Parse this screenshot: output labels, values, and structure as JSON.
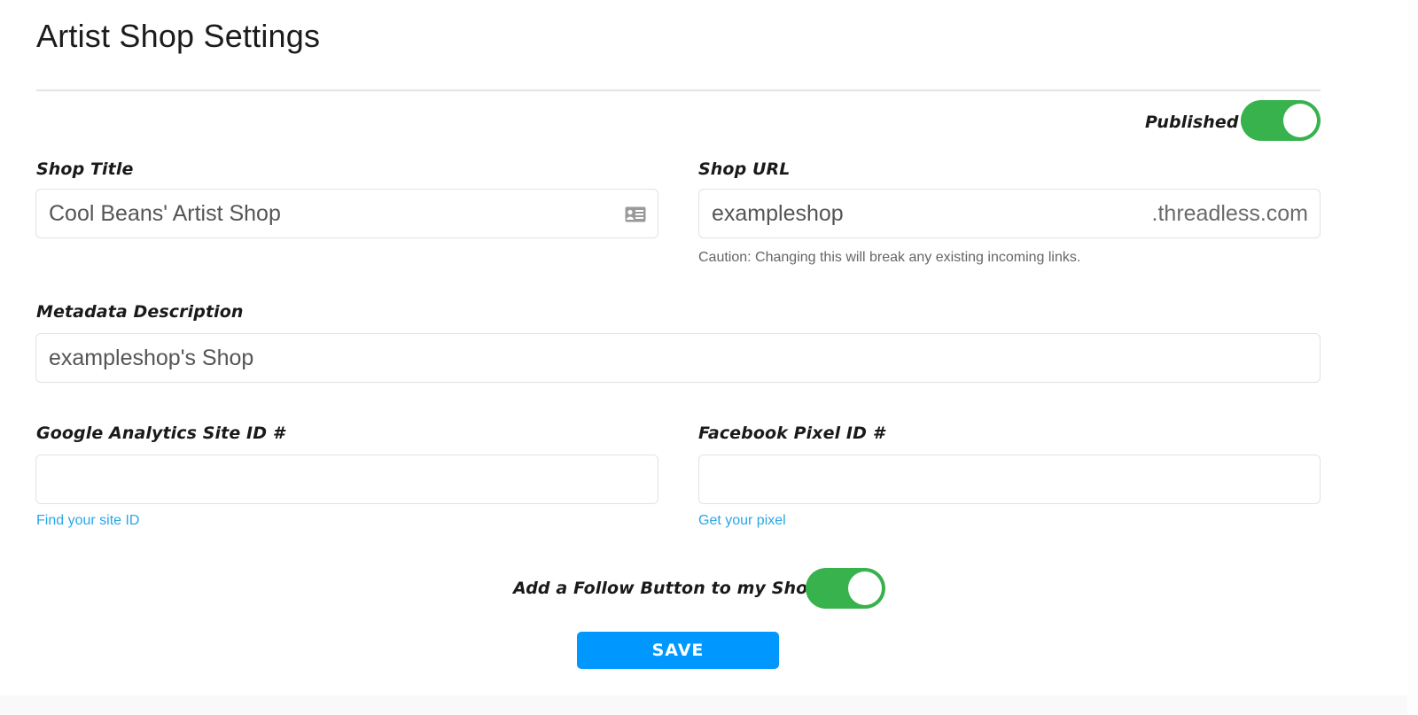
{
  "page": {
    "title": "Artist Shop Settings"
  },
  "published": {
    "label": "Published",
    "on": true
  },
  "shop_title": {
    "label": "Shop Title",
    "value": "Cool Beans' Artist Shop",
    "icon": "contact-card-icon"
  },
  "shop_url": {
    "label": "Shop URL",
    "value": "exampleshop",
    "suffix": ".threadless.com",
    "caution": "Caution: Changing this will break any existing incoming links."
  },
  "metadata_description": {
    "label": "Metadata Description",
    "value": "exampleshop's Shop"
  },
  "google_analytics": {
    "label": "Google Analytics Site ID #",
    "value": "",
    "link": "Find your site ID"
  },
  "facebook_pixel": {
    "label": "Facebook Pixel ID #",
    "value": "",
    "link": "Get your pixel"
  },
  "follow_button": {
    "label": "Add a Follow Button to my Shop",
    "on": true
  },
  "actions": {
    "save_label": "SAVE"
  },
  "colors": {
    "toggle_on": "#37b24d",
    "primary": "#0098ff",
    "link": "#2aa6e8"
  }
}
